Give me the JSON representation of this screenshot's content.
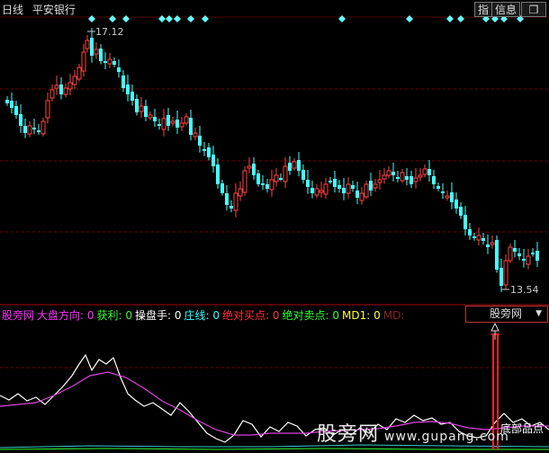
{
  "header": {
    "period": "日线",
    "stock_name": "平安银行"
  },
  "toolbar": {
    "index_label": "指",
    "info_label": "信息",
    "window_icon": "restore-icon"
  },
  "price": {
    "high_label": "17.12",
    "low_label": "13.54"
  },
  "indicator_bar": {
    "items": [
      {
        "label": "股旁网",
        "color": "#ff33ff"
      },
      {
        "label": "大盘方向: 0",
        "color": "#ff33ff"
      },
      {
        "label": "获利: 0",
        "color": "#33ff33"
      },
      {
        "label": "操盘手: 0",
        "color": "#ffffff"
      },
      {
        "label": "庄线: 0",
        "color": "#33ffff"
      },
      {
        "label": "绝对买点: 0",
        "color": "#ff3333"
      },
      {
        "label": "绝对卖点: 0",
        "color": "#33ff33"
      },
      {
        "label": "MD1: 0",
        "color": "#ffff33"
      },
      {
        "label": "MD:",
        "color": "#882222"
      }
    ],
    "selector_value": "股旁网"
  },
  "watermark": {
    "text": "股旁网",
    "url": "www.gupang.com",
    "signal_label": "底部品点"
  },
  "colors": {
    "up": "#ff4444",
    "down": "#44ffff",
    "grid": "#7a0000",
    "marker": "#66ffff"
  }
}
